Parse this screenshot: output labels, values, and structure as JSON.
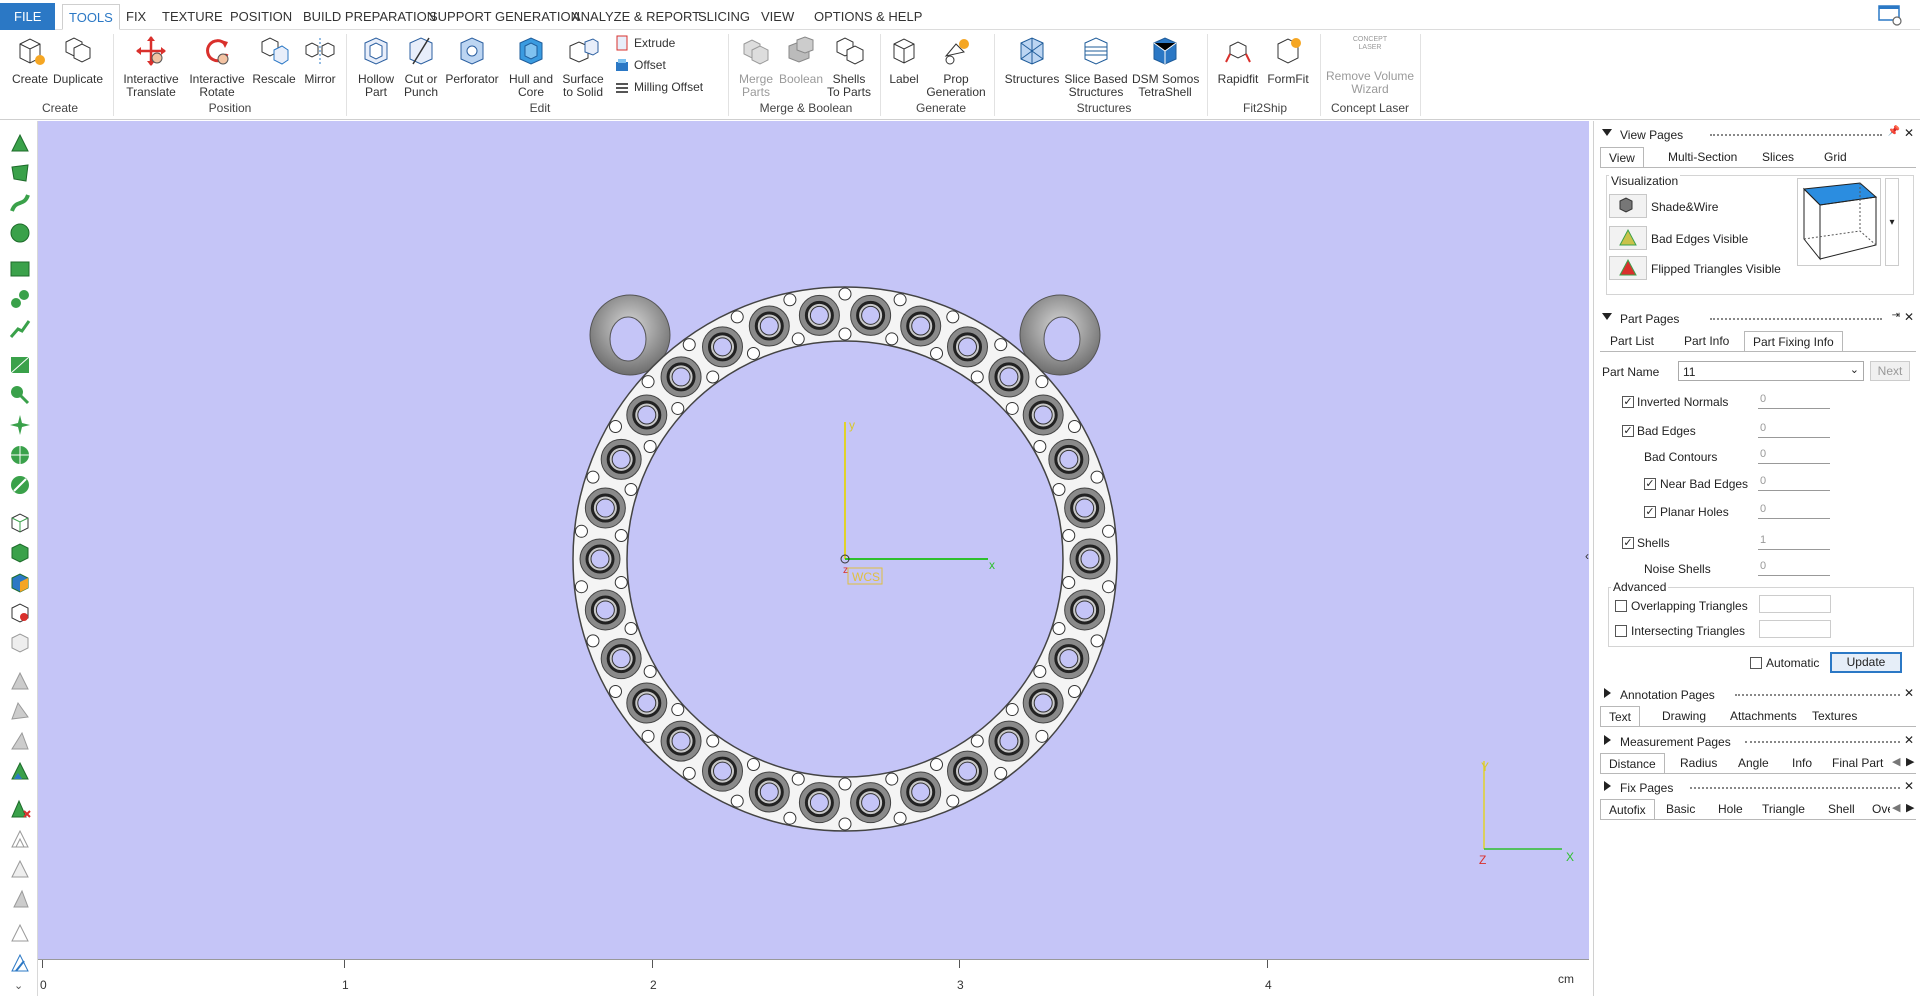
{
  "menu": {
    "tabs": [
      "FILE",
      "TOOLS",
      "FIX",
      "TEXTURE",
      "POSITION",
      "BUILD PREPARATION",
      "SUPPORT GENERATION",
      "ANALYZE & REPORT",
      "SLICING",
      "VIEW",
      "OPTIONS & HELP"
    ],
    "active": "TOOLS"
  },
  "ribbon": {
    "create": "Create",
    "duplicate": "Duplicate",
    "group_create": "Create",
    "interactive_translate": "Interactive\nTranslate",
    "interactive_rotate": "Interactive\nRotate",
    "rescale": "Rescale",
    "mirror": "Mirror",
    "group_position": "Position",
    "hollow_part": "Hollow\nPart",
    "cut_or_punch": "Cut or\nPunch",
    "perforator": "Perforator",
    "hull_and_core": "Hull and\nCore",
    "surface_to_solid": "Surface\nto Solid",
    "extrude": "Extrude",
    "offset": "Offset",
    "milling_offset": "Milling Offset",
    "group_edit": "Edit",
    "merge_parts": "Merge\nParts",
    "boolean": "Boolean",
    "shells_to_parts": "Shells\nTo Parts",
    "group_merge": "Merge & Boolean",
    "label": "Label",
    "prop_generation": "Prop\nGeneration",
    "group_generate": "Generate",
    "structures": "Structures",
    "slice_based_structures": "Slice Based\nStructures",
    "dsm_somos": "DSM Somos\nTetraShell",
    "group_structures": "Structures",
    "rapidfit": "Rapidfit",
    "formfit": "FormFit",
    "group_fit2ship": "Fit2Ship",
    "concept_laser_logo": "CONCEPT\nLASER",
    "remove_volume_wizard": "Remove Volume\nWizard",
    "group_concept_laser": "Concept Laser"
  },
  "viewport": {
    "axis_y": "y",
    "axis_x": "x",
    "axis_z": "z",
    "wcs": "WCS",
    "corner_y": "Y",
    "corner_x": "X",
    "corner_z": "Z"
  },
  "ruler": {
    "labels": [
      "0",
      "1",
      "2",
      "3",
      "4"
    ],
    "unit": "cm"
  },
  "view_pages": {
    "title": "View Pages",
    "tabs": [
      "View",
      "Multi-Section",
      "Slices",
      "Grid"
    ],
    "visualization": "Visualization",
    "shade_wire": "Shade&Wire",
    "bad_edges_visible": "Bad Edges Visible",
    "flipped_triangles_visible": "Flipped Triangles Visible"
  },
  "part_pages": {
    "title": "Part Pages",
    "tabs": [
      "Part List",
      "Part Info",
      "Part Fixing Info"
    ],
    "part_name_label": "Part Name",
    "part_name_value": "11",
    "next": "Next",
    "inverted_normals": "Inverted Normals",
    "inverted_normals_val": "0",
    "bad_edges": "Bad Edges",
    "bad_edges_val": "0",
    "bad_contours": "Bad Contours",
    "bad_contours_val": "0",
    "near_bad_edges": "Near Bad Edges",
    "near_bad_edges_val": "0",
    "planar_holes": "Planar Holes",
    "planar_holes_val": "0",
    "shells": "Shells",
    "shells_val": "1",
    "noise_shells": "Noise Shells",
    "noise_shells_val": "0",
    "advanced": "Advanced",
    "overlapping_triangles": "Overlapping Triangles",
    "intersecting_triangles": "Intersecting Triangles",
    "automatic": "Automatic",
    "update": "Update"
  },
  "annotation_pages": {
    "title": "Annotation Pages",
    "tabs": [
      "Text",
      "Drawing",
      "Attachments",
      "Textures"
    ]
  },
  "measurement_pages": {
    "title": "Measurement Pages",
    "tabs": [
      "Distance",
      "Radius",
      "Angle",
      "Info",
      "Final Part"
    ]
  },
  "fix_pages": {
    "title": "Fix Pages",
    "tabs": [
      "Autofix",
      "Basic",
      "Hole",
      "Triangle",
      "Shell",
      "Over"
    ]
  },
  "colors": {
    "accent": "#2b78c5",
    "viewport_bg": "#c5c5f7"
  }
}
